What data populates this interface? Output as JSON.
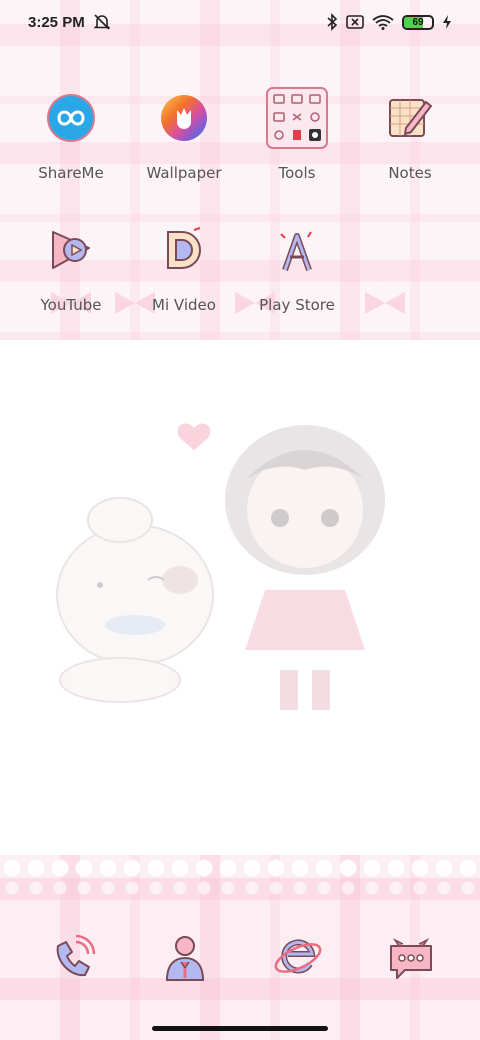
{
  "status_bar": {
    "time": "3:25 PM",
    "battery_level": "69",
    "battery_fraction": 0.69,
    "icons": [
      "alarm-off-icon",
      "bluetooth-icon",
      "no-sim-icon",
      "wifi-icon",
      "battery-icon",
      "charging-icon"
    ]
  },
  "apps": [
    {
      "label": "ShareMe",
      "icon": "shareme-icon"
    },
    {
      "label": "Wallpaper",
      "icon": "wallpaper-icon"
    },
    {
      "label": "Tools",
      "icon": "tools-folder-icon"
    },
    {
      "label": "Notes",
      "icon": "notes-icon"
    },
    {
      "label": "YouTube",
      "icon": "youtube-icon"
    },
    {
      "label": "Mi Video",
      "icon": "mi-video-icon"
    },
    {
      "label": "Play Store",
      "icon": "play-store-icon"
    }
  ],
  "dock": [
    {
      "icon": "phone-icon"
    },
    {
      "icon": "contacts-icon"
    },
    {
      "icon": "browser-icon"
    },
    {
      "icon": "messages-icon"
    }
  ],
  "colors": {
    "accent_pink": "#f7c6d4",
    "icon_stroke": "#7a4b57",
    "lavender": "#b3b8f0"
  }
}
